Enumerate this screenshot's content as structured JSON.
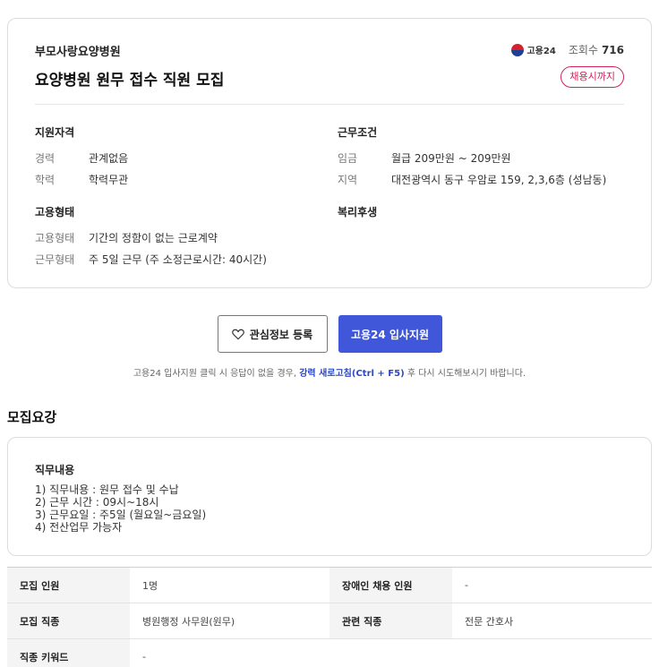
{
  "header": {
    "company": "부모사랑요양병원",
    "title": "요양병원 원무 접수 직원 모집",
    "source_logo_text": "고용24",
    "views_label": "조회수",
    "views_value": "716",
    "deadline_badge": "채용시까지"
  },
  "qualification": {
    "title": "지원자격",
    "rows": [
      {
        "k": "경력",
        "v": "관계없음"
      },
      {
        "k": "학력",
        "v": "학력무관"
      }
    ]
  },
  "conditions": {
    "title": "근무조건",
    "rows": [
      {
        "k": "임금",
        "v": "월급 209만원 ~ 209만원"
      },
      {
        "k": "지역",
        "v": "대전광역시 동구 우암로 159, 2,3,6층 (성남동)"
      }
    ]
  },
  "employment": {
    "title": "고용형태",
    "rows": [
      {
        "k": "고용형태",
        "v": "기간의 정함이 없는 근로계약"
      },
      {
        "k": "근무형태",
        "v": "주 5일 근무 (주 소정근로시간: 40시간)"
      }
    ]
  },
  "welfare": {
    "title": "복리후생"
  },
  "actions": {
    "favorite_label": "관심정보 등록",
    "apply_label": "고용24 입사지원"
  },
  "notice": {
    "before": "고용24 입사지원 클릭 시 응답이 없을 경우, ",
    "strong": "강력 새로고침(Ctrl + F5)",
    "after": " 후 다시 시도해보시기 바랍니다."
  },
  "recruit": {
    "heading": "모집요강",
    "duty_title": "직무내용",
    "duty_lines": [
      "1) 직무내용 : 원무 접수 및 수납",
      "2) 근무 시간 : 09시~18시",
      "3) 근무요일 : 주5일 (월요일~금요일)",
      "4) 전산업무 가능자"
    ]
  },
  "table": {
    "rows": [
      {
        "h1": "모집 인원",
        "v1": "1명",
        "h2": "장애인 채용 인원",
        "v2": "-"
      },
      {
        "h1": "모집 직종",
        "v1": "병원행정 사무원(원무)",
        "h2": "관련 직종",
        "v2": "전문 간호사"
      },
      {
        "h1": "직종 키워드",
        "v1": "-",
        "h2": "",
        "v2": ""
      }
    ]
  },
  "colors": {
    "accent": "#3f57d8",
    "badge": "#d1245a"
  }
}
